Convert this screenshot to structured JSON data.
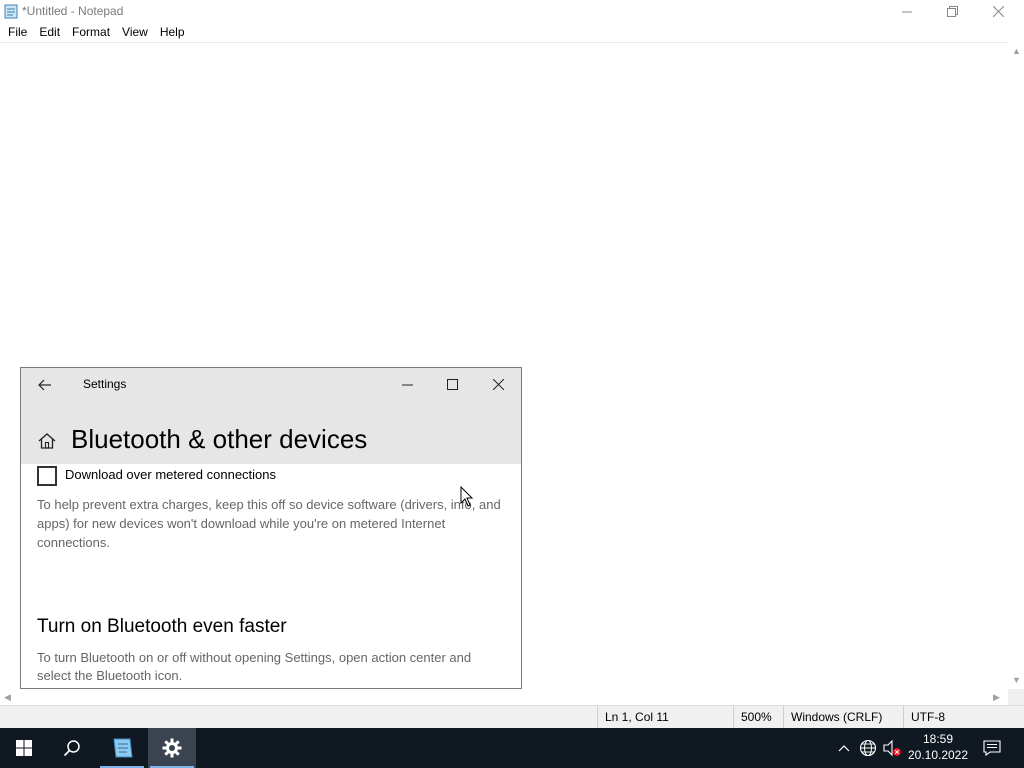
{
  "notepad": {
    "title": "*Untitled - Notepad",
    "menu": [
      "File",
      "Edit",
      "Format",
      "View",
      "Help"
    ],
    "content": "",
    "statusbar": {
      "position": "Ln 1, Col 11",
      "zoom": "500%",
      "line_ending": "Windows (CRLF)",
      "encoding": "UTF-8"
    }
  },
  "settings": {
    "window_title": "Settings",
    "page_title": "Bluetooth & other devices",
    "metered_checkbox": {
      "label": "Download over metered connections",
      "checked": false
    },
    "metered_description": "To help prevent extra charges, keep this off so device software (drivers, info, and apps) for new devices won't download while you're on metered Internet connections.",
    "faster_title": "Turn on Bluetooth even faster",
    "faster_description": "To turn Bluetooth on or off without opening Settings, open action center and select the Bluetooth icon."
  },
  "taskbar": {
    "pinned": [
      "start-icon",
      "search-icon",
      "notepad-icon",
      "settings-gear-icon"
    ],
    "active": "settings-gear-icon",
    "tray": [
      "chevron-up-icon",
      "network-globe-icon",
      "volume-muted-icon",
      "notification-icon"
    ],
    "time": "18:59",
    "date": "20.10.2022"
  },
  "colors": {
    "settings_header": "#e6e6e6",
    "taskbar": "#101922",
    "taskbar_active": "#3a4350",
    "accent": "#7eb4ea"
  }
}
